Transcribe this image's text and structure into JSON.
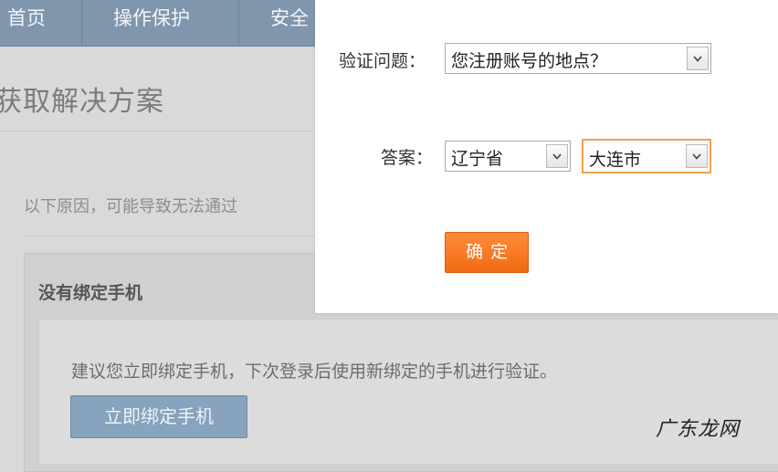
{
  "nav": {
    "items": [
      {
        "label": "首页"
      },
      {
        "label": "操作保护"
      },
      {
        "label": "安全"
      }
    ]
  },
  "page": {
    "title": "获取解决方案",
    "reason_text": "以下原因，可能导致无法通过",
    "section": {
      "title": "没有绑定手机",
      "suggestion": "建议您立即绑定手机，下次登录后使用新绑定的手机进行验证。",
      "bind_button": "立即绑定手机"
    }
  },
  "modal": {
    "question_label": "验证问题：",
    "question_value": "您注册账号的地点？",
    "answer_label": "答案：",
    "province_value": "辽宁省",
    "city_value": "大连市",
    "confirm_label": "确定"
  },
  "watermark": "广东龙网",
  "colors": {
    "nav_bg": "#7f96ad",
    "confirm_bg": "#f06a12",
    "highlight_border": "#f0a04a",
    "bind_button_bg": "#87a3bd"
  }
}
